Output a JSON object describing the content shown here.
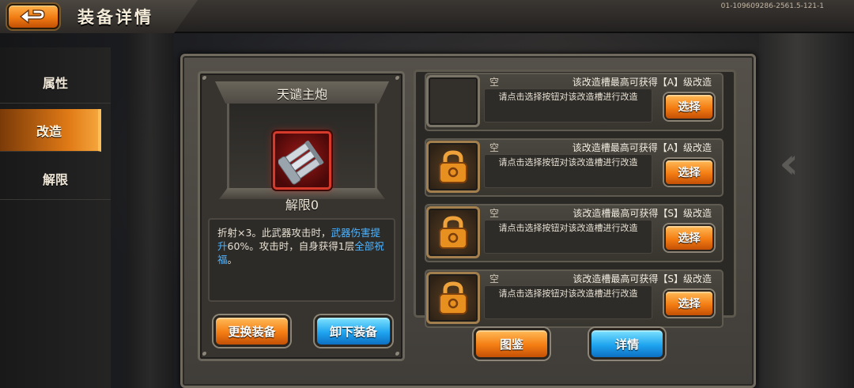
{
  "header": {
    "title": "装备详情",
    "version": "01-109609286-2561.5-121-1"
  },
  "sidenav": {
    "items": [
      {
        "label": "属性",
        "active": false
      },
      {
        "label": "改造",
        "active": true
      },
      {
        "label": "解限",
        "active": false
      }
    ]
  },
  "equipment": {
    "name": "天谴主炮",
    "unlock_level": "解限0",
    "description": {
      "part1": "折射×3。此武器攻击时，",
      "highlight1": "武器伤害提升",
      "part2": "60%。攻击时，自身获得1层",
      "highlight2": "全部祝福",
      "part3": "。"
    },
    "buttons": {
      "replace": "更换装备",
      "unequip": "卸下装备"
    }
  },
  "slots": [
    {
      "status": "空",
      "grade_text": "该改造槽最高可获得【A】级改造",
      "hint": "请点击选择按钮对该改造槽进行改造",
      "select_label": "选择",
      "locked": false
    },
    {
      "status": "空",
      "grade_text": "该改造槽最高可获得【A】级改造",
      "hint": "请点击选择按钮对该改造槽进行改造",
      "select_label": "选择",
      "locked": true
    },
    {
      "status": "空",
      "grade_text": "该改造槽最高可获得【S】级改造",
      "hint": "请点击选择按钮对该改造槽进行改造",
      "select_label": "选择",
      "locked": true
    },
    {
      "status": "空",
      "grade_text": "该改造槽最高可获得【S】级改造",
      "hint": "请点击选择按钮对该改造槽进行改造",
      "select_label": "选择",
      "locked": true
    }
  ],
  "bottom_buttons": {
    "codex": "图鉴",
    "detail": "详情"
  },
  "colors": {
    "accent_orange": "#f47d13",
    "accent_blue": "#1fa4ef",
    "highlight_text": "#4db4ff",
    "item_frame_red": "#d53a2b"
  }
}
